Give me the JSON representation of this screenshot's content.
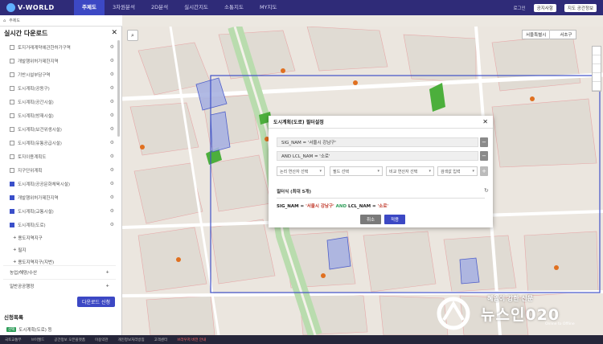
{
  "brand": {
    "name": "V-WORLD"
  },
  "nav": {
    "items": [
      "주제도",
      "3차원분석",
      "2D분석",
      "실시간지도",
      "소통지도",
      "MY지도"
    ]
  },
  "top_right": {
    "login": "로그인",
    "btn1": "공지사항",
    "btn2": "지도 공간정보"
  },
  "subbar": {
    "label": "주제도"
  },
  "panel": {
    "title": "실시간 다운로드",
    "layers": [
      {
        "label": "토지거래계약에관한허가구역",
        "checked": false
      },
      {
        "label": "개발행위허가제한지역",
        "checked": false
      },
      {
        "label": "기반시설부담구역",
        "checked": false
      },
      {
        "label": "도시계획(공동구)",
        "checked": false
      },
      {
        "label": "도시계획(공간시설)",
        "checked": false
      },
      {
        "label": "도시계획(방재시설)",
        "checked": false
      },
      {
        "label": "도시계획(보건위생시설)",
        "checked": false
      },
      {
        "label": "도시계획(유통공급시설)",
        "checked": false
      },
      {
        "label": "토지이용계획도",
        "checked": false
      },
      {
        "label": "지구단위계획",
        "checked": false
      },
      {
        "label": "도시계획(공공문화체육시설)",
        "checked": true
      },
      {
        "label": "개발행위허가제한지역",
        "checked": true
      },
      {
        "label": "도시계획(교통시설)",
        "checked": true
      },
      {
        "label": "도시계획(도로)",
        "checked": true
      }
    ],
    "subitems": [
      "용도지역지구",
      "필지",
      "용도지역지구(지번)"
    ],
    "categories": [
      "농업/해양/수산",
      "일반공공행정"
    ],
    "download_label": "다운로드 신청",
    "section_title": "신청목록",
    "result_tag": "선택",
    "result_label": "도시계획(도로) 등"
  },
  "map": {
    "region_city": "서울특별시",
    "region_district": "서초구"
  },
  "dialog": {
    "title": "도시계획(도로) 필터설정",
    "conditions": [
      "SIG_NAM = '서울시 강남구'",
      "AND LCL_NAM = '소로'"
    ],
    "select_logic": "논리 연산자 선택",
    "select_field": "필드 선택",
    "select_compare": "비교 연산자 선택",
    "input_placeholder": "검색값 입력",
    "formula_title": "필터식 (최대 5개)",
    "formula_field1": "SIG_NAM",
    "formula_eq1": " = ",
    "formula_value1": "'서울시 강남구'",
    "formula_and": " AND ",
    "formula_field2": "LCL_NAM",
    "formula_eq2": " = ",
    "formula_value2": "'소로'",
    "cancel_label": "취소",
    "apply_label": "적용"
  },
  "statusbar": {
    "items": [
      "국토교통부",
      "브이월드",
      "공간정보 오픈플랫폼",
      "이용약관",
      "개인정보처리방침",
      "고객센터"
    ],
    "highlight": "브라우저 버전 안내"
  },
  "watermark": {
    "top": "혜임이 강한 신문",
    "main": "뉴스인020",
    "sub": "Online to Offline"
  },
  "colors": {
    "nav": "#2f2b78",
    "active": "#3c48c4",
    "road": "#a8d8a0",
    "filter_box": "#3f51c8"
  }
}
